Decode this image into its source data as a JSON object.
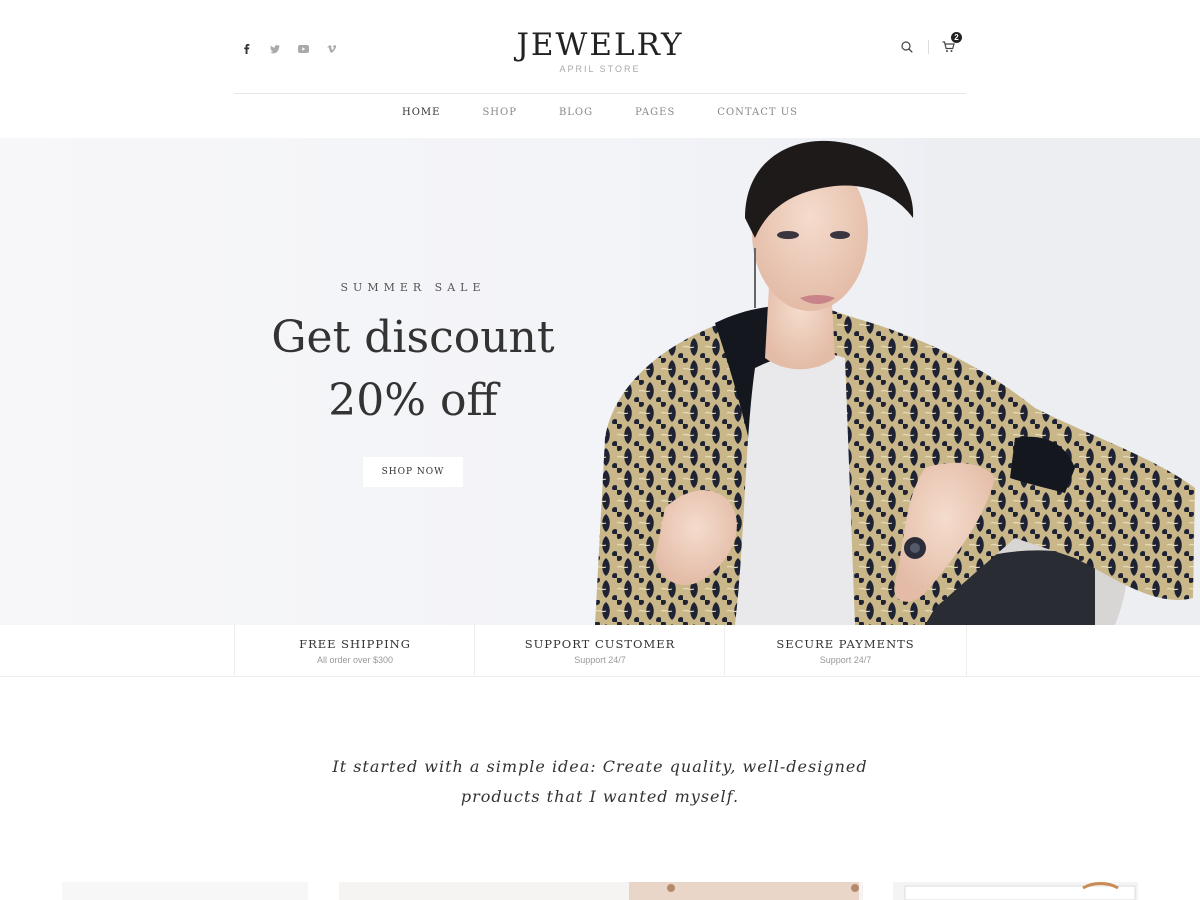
{
  "header": {
    "logo_title": "JEWELRY",
    "logo_subtitle": "APRIL STORE",
    "social": [
      {
        "icon": "facebook-icon"
      },
      {
        "icon": "twitter-icon"
      },
      {
        "icon": "youtube-icon"
      },
      {
        "icon": "vimeo-icon"
      }
    ],
    "cart_count": "2"
  },
  "nav": {
    "items": [
      "HOME",
      "SHOP",
      "BLOG",
      "PAGES",
      "CONTACT US"
    ],
    "active": "HOME"
  },
  "hero": {
    "kicker": "SUMMER SALE",
    "title_line1": "Get discount",
    "title_line2": "20% off",
    "button_label": "SHOP NOW"
  },
  "features": [
    {
      "title": "FREE SHIPPING",
      "subtitle": "All order over $300"
    },
    {
      "title": "SUPPORT CUSTOMER",
      "subtitle": "Support 24/7"
    },
    {
      "title": "SECURE PAYMENTS",
      "subtitle": "Support 24/7"
    }
  ],
  "quote": {
    "line1": "It started with a simple idea: Create quality, well-designed",
    "line2": "products that I wanted myself."
  },
  "colors": {
    "text_dark": "#333333",
    "text_muted": "#999999",
    "hero_bg": "#f3f4f8",
    "badge": "#222222"
  }
}
